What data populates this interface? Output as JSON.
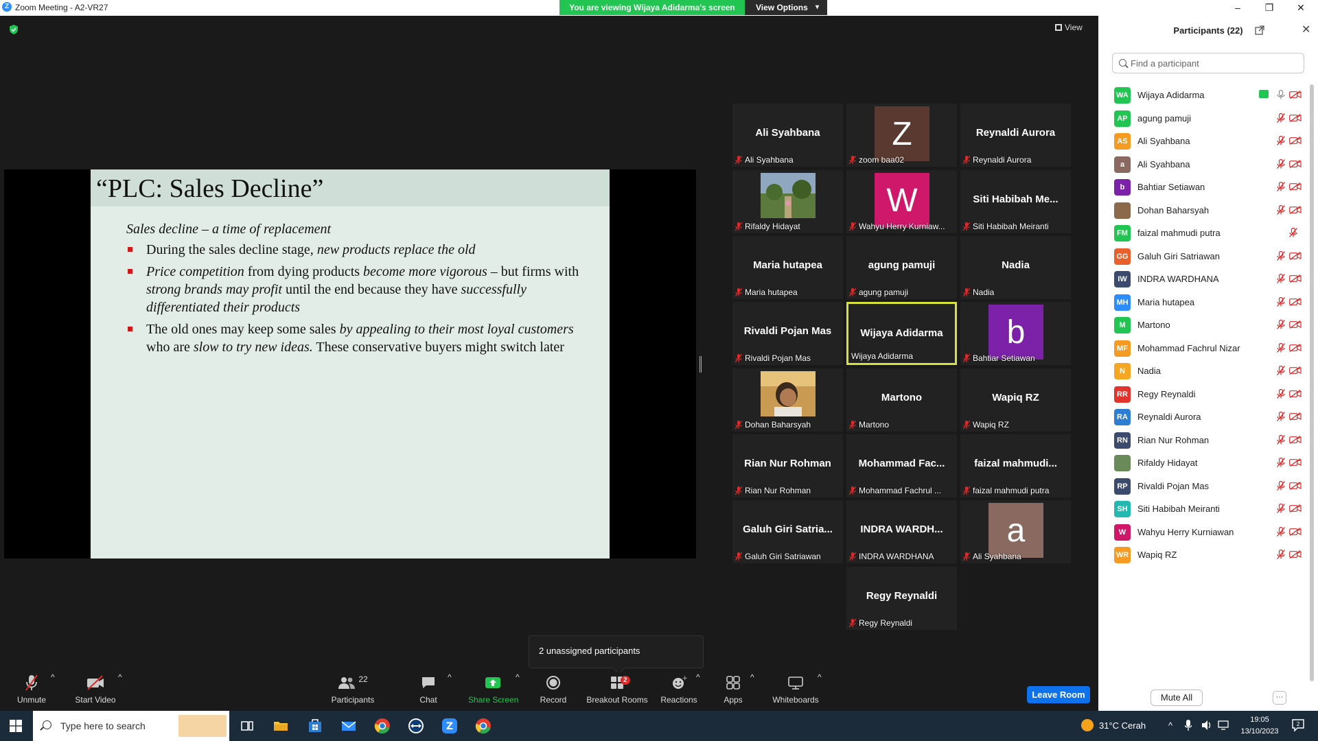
{
  "window": {
    "title": "Zoom Meeting - A2-VR27",
    "app_icon_letter": "Z",
    "controls": [
      "–",
      "❐",
      "✕"
    ]
  },
  "banner": {
    "message": "You are viewing Wijaya Adidarma's screen",
    "view_options": "View Options"
  },
  "view_button": "View",
  "slide": {
    "title": "“PLC: Sales Decline”",
    "subtitle_italic": "Sales decline",
    "subtitle_rest": " – a time of replacement",
    "bullets": [
      {
        "parts": [
          {
            "t": "During the sales decline stage, ",
            "i": false
          },
          {
            "t": "new products replace the old",
            "i": true
          }
        ]
      },
      {
        "parts": [
          {
            "t": "Price competition",
            "i": true
          },
          {
            "t": " from dying products ",
            "i": false
          },
          {
            "t": "become more vigorous",
            "i": true
          },
          {
            "t": " – but firms with ",
            "i": false
          },
          {
            "t": "strong brands may profit",
            "i": true
          },
          {
            "t": " until the end because they have ",
            "i": false
          },
          {
            "t": "successfully differentiated their products",
            "i": true
          }
        ]
      },
      {
        "parts": [
          {
            "t": "The old ones may keep some sales ",
            "i": false
          },
          {
            "t": "by appealing to their most loyal customers",
            "i": true
          },
          {
            "t": " who are ",
            "i": false
          },
          {
            "t": "slow to try new ideas.",
            "i": true
          },
          {
            "t": " These conservative buyers might switch later",
            "i": false
          }
        ]
      }
    ]
  },
  "tiles": [
    {
      "big": "Ali Syahbana",
      "label": "Ali Syahbana",
      "muted": true
    },
    {
      "avatar": "Z",
      "avatar_color": "#5a3a30",
      "label": "zoom baa02",
      "muted": true
    },
    {
      "big": "Reynaldi Aurora",
      "label": "Reynaldi Aurora",
      "muted": true
    },
    {
      "photo": "garden",
      "label": "Rifaldy Hidayat",
      "muted": true
    },
    {
      "avatar": "W",
      "avatar_color": "#d0186a",
      "label": "Wahyu Herry Kurniaw...",
      "muted": true
    },
    {
      "big": "Siti  Habibah  Me...",
      "label": "Siti Habibah Meiranti",
      "muted": true
    },
    {
      "big": "Maria hutapea",
      "label": "Maria hutapea",
      "muted": true
    },
    {
      "big": "agung pamuji",
      "label": "agung pamuji",
      "muted": true
    },
    {
      "big": "Nadia",
      "label": "Nadia",
      "muted": true
    },
    {
      "big": "Rivaldi Pojan Mas",
      "label": "Rivaldi Pojan Mas",
      "muted": true
    },
    {
      "big": "Wijaya Adidarma",
      "label": "Wijaya Adidarma",
      "muted": false,
      "active": true
    },
    {
      "avatar": "b",
      "avatar_color": "#7b22a8",
      "label": "Bahtiar Setiawan",
      "muted": true
    },
    {
      "photo": "person",
      "label": "Dohan Baharsyah",
      "muted": true
    },
    {
      "big": "Martono",
      "label": "Martono",
      "muted": true
    },
    {
      "big": "Wapiq RZ",
      "label": "Wapiq RZ",
      "muted": true
    },
    {
      "big": "Rian Nur Rohman",
      "label": "Rian Nur Rohman",
      "muted": true
    },
    {
      "big": "Mohammad  Fac...",
      "label": "Mohammad Fachrul ...",
      "muted": true
    },
    {
      "big": "faizal  mahmudi...",
      "label": "faizal mahmudi putra",
      "muted": true
    },
    {
      "big": "Galuh  Giri  Satria...",
      "label": "Galuh Giri Satriawan",
      "muted": true
    },
    {
      "big": "INDRA  WARDH...",
      "label": "INDRA WARDHANA",
      "muted": true
    },
    {
      "avatar": "a",
      "avatar_color": "#8a6a60",
      "label": "Ali Syahbana",
      "muted": true
    },
    {
      "big": "Regy Reynaldi",
      "label": "Regy Reynaldi",
      "muted": true
    }
  ],
  "toast": "2 unassigned participants",
  "toolbar": {
    "unmute": "Unmute",
    "start_video": "Start Video",
    "participants": "Participants",
    "participants_count": "22",
    "chat": "Chat",
    "share_screen": "Share Screen",
    "record": "Record",
    "breakout_rooms": "Breakout Rooms",
    "breakout_badge": "2",
    "reactions": "Reactions",
    "apps": "Apps",
    "whiteboards": "Whiteboards",
    "leave_room": "Leave Room"
  },
  "panel": {
    "title": "Participants (22)",
    "search_placeholder": "Find a participant",
    "mute_all": "Mute All",
    "more": "···",
    "participants": [
      {
        "initials": "WA",
        "color": "#23c552",
        "name": "Wijaya Adidarma",
        "sharing": true,
        "mic_muted": false,
        "video_off": true
      },
      {
        "initials": "AP",
        "color": "#23c552",
        "name": "agung pamuji",
        "mic_muted": true,
        "video_off": true
      },
      {
        "initials": "AS",
        "color": "#f59a23",
        "name": "Ali Syahbana",
        "mic_muted": true,
        "video_off": true
      },
      {
        "initials": "a",
        "color": "#8a6a60",
        "name": "Ali Syahbana",
        "mic_muted": true,
        "video_off": true
      },
      {
        "initials": "b",
        "color": "#7b22a8",
        "name": "Bahtiar Setiawan",
        "mic_muted": true,
        "video_off": true
      },
      {
        "initials": "",
        "color": "#8a6a4a",
        "photo": true,
        "name": "Dohan Baharsyah",
        "mic_muted": true,
        "video_off": true
      },
      {
        "initials": "FM",
        "color": "#23c552",
        "name": "faizal mahmudi putra",
        "mic_muted": true,
        "video_off": false
      },
      {
        "initials": "GG",
        "color": "#e8602c",
        "name": "Galuh Giri Satriawan",
        "mic_muted": true,
        "video_off": true
      },
      {
        "initials": "IW",
        "color": "#3c4a6e",
        "name": "INDRA WARDHANA",
        "mic_muted": true,
        "video_off": true
      },
      {
        "initials": "MH",
        "color": "#2d8cff",
        "name": "Maria hutapea",
        "mic_muted": true,
        "video_off": true
      },
      {
        "initials": "M",
        "color": "#23c552",
        "name": "Martono",
        "mic_muted": true,
        "video_off": true
      },
      {
        "initials": "MF",
        "color": "#f59a23",
        "name": "Mohammad Fachrul Nizar",
        "mic_muted": true,
        "video_off": true
      },
      {
        "initials": "N",
        "color": "#f5a623",
        "name": "Nadia",
        "mic_muted": true,
        "video_off": true
      },
      {
        "initials": "RR",
        "color": "#e0342c",
        "name": "Regy Reynaldi",
        "mic_muted": true,
        "video_off": true
      },
      {
        "initials": "RA",
        "color": "#2d7dd2",
        "name": "Reynaldi Aurora",
        "mic_muted": true,
        "video_off": true
      },
      {
        "initials": "RN",
        "color": "#3c4a6e",
        "name": "Rian Nur Rohman",
        "mic_muted": true,
        "video_off": true
      },
      {
        "initials": "",
        "color": "#6a8a5a",
        "photo": true,
        "name": "Rifaldy Hidayat",
        "mic_muted": true,
        "video_off": true
      },
      {
        "initials": "RP",
        "color": "#3c4a6e",
        "name": "Rivaldi Pojan Mas",
        "mic_muted": true,
        "video_off": true
      },
      {
        "initials": "SH",
        "color": "#23b8b0",
        "name": "Siti Habibah Meiranti",
        "mic_muted": true,
        "video_off": true
      },
      {
        "initials": "W",
        "color": "#d0186a",
        "name": "Wahyu Herry Kurniawan",
        "mic_muted": true,
        "video_off": true
      },
      {
        "initials": "WR",
        "color": "#f59a23",
        "name": "Wapiq RZ",
        "mic_muted": true,
        "video_off": true
      }
    ]
  },
  "taskbar": {
    "search_placeholder": "Type here to search",
    "weather": "31°C  Cerah",
    "time": "19:05",
    "date": "13/10/2023",
    "notification_count": "2"
  }
}
